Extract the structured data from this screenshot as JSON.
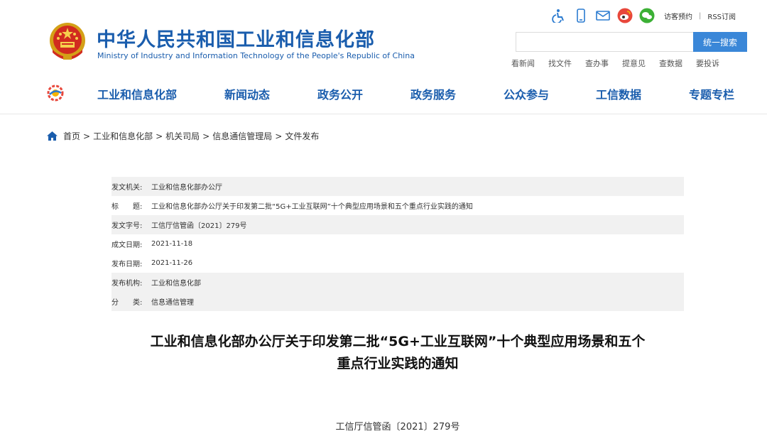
{
  "header": {
    "title": "中华人民共和国工业和信息化部",
    "subtitle": "Ministry of Industry and Information Technology of the People's Republic of China",
    "emblem_icon": "national-emblem-icon",
    "tools": {
      "icons": [
        "accessibility-icon",
        "mobile-icon",
        "mail-icon",
        "weibo-icon",
        "wechat-icon"
      ],
      "visit_label": "访客预约",
      "separator": "|",
      "rss_label": "RSS订阅"
    },
    "search": {
      "value": "",
      "placeholder": "",
      "button_label": "统一搜索"
    },
    "quick_links": [
      "看新闻",
      "找文件",
      "查办事",
      "提意见",
      "查数据",
      "要投诉"
    ],
    "nav": [
      "工业和信息化部",
      "新闻动态",
      "政务公开",
      "政务服务",
      "公众参与",
      "工信数据",
      "专题专栏"
    ]
  },
  "breadcrumb": {
    "home_icon": "home-icon",
    "separator": ">",
    "items": [
      "首页",
      "工业和信息化部",
      "机关司局",
      "信息通信管理局",
      "文件发布"
    ]
  },
  "info": [
    {
      "label": "发文机关:",
      "value": "工业和信息化部办公厅"
    },
    {
      "label": "标　　题:",
      "value": "工业和信息化部办公厅关于印发第二批“5G+工业互联网”十个典型应用场景和五个重点行业实践的通知"
    },
    {
      "label": "发文字号:",
      "value": "工信厅信管函〔2021〕279号"
    },
    {
      "label": "成文日期:",
      "value": "2021-11-18"
    },
    {
      "label": "发布日期:",
      "value": "2021-11-26"
    },
    {
      "label": "发布机构:",
      "value": "工业和信息化部"
    },
    {
      "label": "分　　类:",
      "value": "信息通信管理"
    }
  ],
  "document": {
    "title_line1": "工业和信息化部办公厅关于印发第二批“5G+工业互联网”十个典型应用场景和五个",
    "title_line2": "重点行业实践的通知",
    "number": "工信厅信管函〔2021〕279号"
  },
  "colors": {
    "brand_blue": "#1a5dad",
    "search_button": "#3a87d8",
    "row_shade": "#f1f1f1"
  }
}
